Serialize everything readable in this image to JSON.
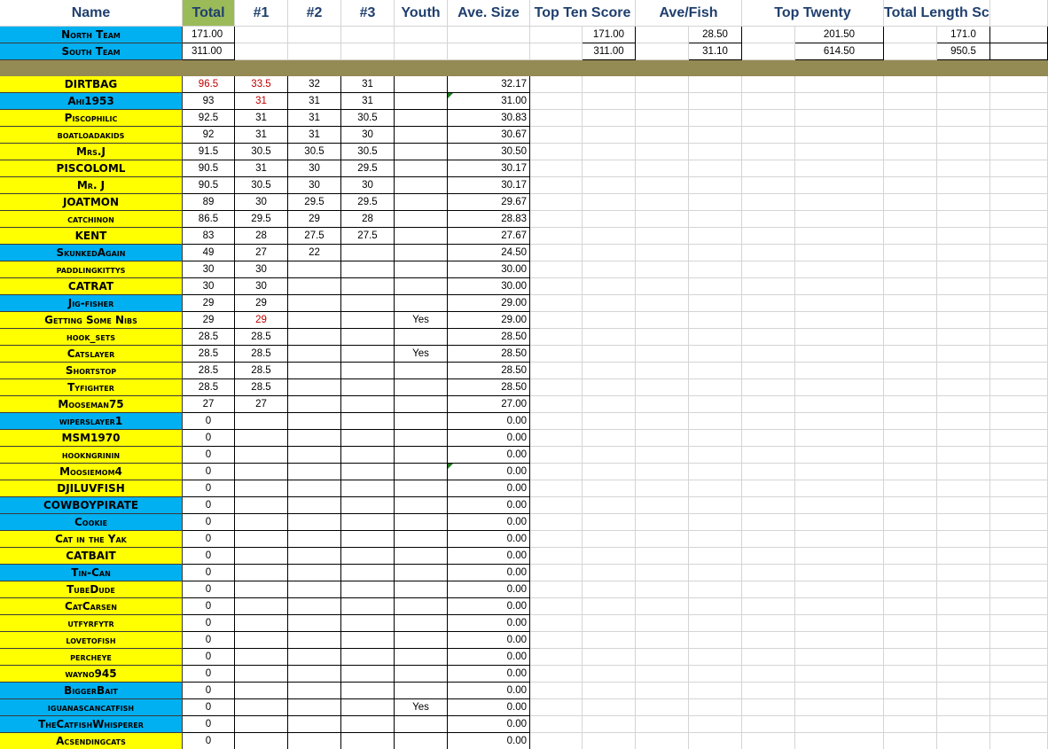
{
  "headers": {
    "name": "Name",
    "total": "Total",
    "r1": "#1",
    "r2": "#2",
    "r3": "#3",
    "youth": "Youth",
    "ave_size": "Ave. Size",
    "top_ten_score": "Top Ten Score",
    "ave_fish": "Ave/Fish",
    "top_twenty": "Top Twenty",
    "total_length_scored": "Total Length Scored"
  },
  "teams": [
    {
      "name": "North Team",
      "total": "171.00",
      "top_ten": "171.00",
      "ave_fish": "28.50",
      "top_twenty": "201.50",
      "total_length": "171.0"
    },
    {
      "name": "South Team",
      "total": "311.00",
      "top_ten": "311.00",
      "ave_fish": "31.10",
      "top_twenty": "614.50",
      "total_length": "950.5"
    }
  ],
  "colors": {
    "header_total": "#9bbb59",
    "header_text": "#1f3f6e",
    "band": "#948a54",
    "name_yellow": "#ffff00",
    "name_blue": "#00b0f0",
    "highlight_red": "#c00000",
    "comment_marker": "#1e7b1e"
  },
  "anglers": [
    {
      "name": "DIRTBAG",
      "color": "yellow",
      "total": "96.5",
      "r1": "33.5",
      "r2": "32",
      "r3": "31",
      "youth": "",
      "ave": "32.17",
      "total_red": true,
      "r1_red": true,
      "ave_marker": false
    },
    {
      "name": "Ahi1953",
      "color": "blue",
      "total": "93",
      "r1": "31",
      "r2": "31",
      "r3": "31",
      "youth": "",
      "ave": "31.00",
      "total_red": false,
      "r1_red": true,
      "ave_marker": true
    },
    {
      "name": "Piscophilic",
      "color": "yellow",
      "total": "92.5",
      "r1": "31",
      "r2": "31",
      "r3": "30.5",
      "youth": "",
      "ave": "30.83"
    },
    {
      "name": "boatloadakids",
      "color": "yellow",
      "total": "92",
      "r1": "31",
      "r2": "31",
      "r3": "30",
      "youth": "",
      "ave": "30.67"
    },
    {
      "name": "Mrs.J",
      "color": "yellow",
      "total": "91.5",
      "r1": "30.5",
      "r2": "30.5",
      "r3": "30.5",
      "youth": "",
      "ave": "30.50"
    },
    {
      "name": "PISCOLOML",
      "color": "yellow",
      "total": "90.5",
      "r1": "31",
      "r2": "30",
      "r3": "29.5",
      "youth": "",
      "ave": "30.17"
    },
    {
      "name": "Mr. J",
      "color": "yellow",
      "total": "90.5",
      "r1": "30.5",
      "r2": "30",
      "r3": "30",
      "youth": "",
      "ave": "30.17"
    },
    {
      "name": "JOATMON",
      "color": "yellow",
      "total": "89",
      "r1": "30",
      "r2": "29.5",
      "r3": "29.5",
      "youth": "",
      "ave": "29.67"
    },
    {
      "name": "catchinon",
      "color": "yellow",
      "total": "86.5",
      "r1": "29.5",
      "r2": "29",
      "r3": "28",
      "youth": "",
      "ave": "28.83"
    },
    {
      "name": "KENT",
      "color": "yellow",
      "total": "83",
      "r1": "28",
      "r2": "27.5",
      "r3": "27.5",
      "youth": "",
      "ave": "27.67"
    },
    {
      "name": "SkunkedAgain",
      "color": "blue",
      "total": "49",
      "r1": "27",
      "r2": "22",
      "r3": "",
      "youth": "",
      "ave": "24.50"
    },
    {
      "name": "paddlingkittys",
      "color": "yellow",
      "total": "30",
      "r1": "30",
      "r2": "",
      "r3": "",
      "youth": "",
      "ave": "30.00"
    },
    {
      "name": "CATRAT",
      "color": "yellow",
      "total": "30",
      "r1": "30",
      "r2": "",
      "r3": "",
      "youth": "",
      "ave": "30.00"
    },
    {
      "name": "Jig-fisher",
      "color": "blue",
      "total": "29",
      "r1": "29",
      "r2": "",
      "r3": "",
      "youth": "",
      "ave": "29.00"
    },
    {
      "name": "Getting Some Nibs",
      "color": "yellow",
      "total": "29",
      "r1": "29",
      "r2": "",
      "r3": "",
      "youth": "Yes",
      "ave": "29.00",
      "r1_red": true
    },
    {
      "name": "hook_sets",
      "color": "yellow",
      "total": "28.5",
      "r1": "28.5",
      "r2": "",
      "r3": "",
      "youth": "",
      "ave": "28.50"
    },
    {
      "name": "Catslayer",
      "color": "yellow",
      "total": "28.5",
      "r1": "28.5",
      "r2": "",
      "r3": "",
      "youth": "Yes",
      "ave": "28.50"
    },
    {
      "name": "Shortstop",
      "color": "yellow",
      "total": "28.5",
      "r1": "28.5",
      "r2": "",
      "r3": "",
      "youth": "",
      "ave": "28.50"
    },
    {
      "name": "Tyfighter",
      "color": "yellow",
      "total": "28.5",
      "r1": "28.5",
      "r2": "",
      "r3": "",
      "youth": "",
      "ave": "28.50"
    },
    {
      "name": "Mooseman75",
      "color": "yellow",
      "total": "27",
      "r1": "27",
      "r2": "",
      "r3": "",
      "youth": "",
      "ave": "27.00"
    },
    {
      "name": "wiperslayer1",
      "color": "blue",
      "total": "0",
      "r1": "",
      "r2": "",
      "r3": "",
      "youth": "",
      "ave": "0.00"
    },
    {
      "name": "MSM1970",
      "color": "yellow",
      "total": "0",
      "r1": "",
      "r2": "",
      "r3": "",
      "youth": "",
      "ave": "0.00"
    },
    {
      "name": "hookngrinin",
      "color": "yellow",
      "total": "0",
      "r1": "",
      "r2": "",
      "r3": "",
      "youth": "",
      "ave": "0.00"
    },
    {
      "name": "Moosiemom4",
      "color": "yellow",
      "total": "0",
      "r1": "",
      "r2": "",
      "r3": "",
      "youth": "",
      "ave": "0.00",
      "ave_marker": true
    },
    {
      "name": "DJILUVFISH",
      "color": "yellow",
      "total": "0",
      "r1": "",
      "r2": "",
      "r3": "",
      "youth": "",
      "ave": "0.00"
    },
    {
      "name": "COWBOYPIRATE",
      "color": "blue",
      "total": "0",
      "r1": "",
      "r2": "",
      "r3": "",
      "youth": "",
      "ave": "0.00"
    },
    {
      "name": "Cookie",
      "color": "blue",
      "total": "0",
      "r1": "",
      "r2": "",
      "r3": "",
      "youth": "",
      "ave": "0.00"
    },
    {
      "name": "Cat in the Yak",
      "color": "yellow",
      "total": "0",
      "r1": "",
      "r2": "",
      "r3": "",
      "youth": "",
      "ave": "0.00"
    },
    {
      "name": "CATBAIT",
      "color": "yellow",
      "total": "0",
      "r1": "",
      "r2": "",
      "r3": "",
      "youth": "",
      "ave": "0.00"
    },
    {
      "name": "Tin-Can",
      "color": "blue",
      "total": "0",
      "r1": "",
      "r2": "",
      "r3": "",
      "youth": "",
      "ave": "0.00"
    },
    {
      "name": "TubeDude",
      "color": "yellow",
      "total": "0",
      "r1": "",
      "r2": "",
      "r3": "",
      "youth": "",
      "ave": "0.00"
    },
    {
      "name": "CatCarsen",
      "color": "yellow",
      "total": "0",
      "r1": "",
      "r2": "",
      "r3": "",
      "youth": "",
      "ave": "0.00"
    },
    {
      "name": "utfyrfytr",
      "color": "yellow",
      "total": "0",
      "r1": "",
      "r2": "",
      "r3": "",
      "youth": "",
      "ave": "0.00"
    },
    {
      "name": "lovetofish",
      "color": "yellow",
      "total": "0",
      "r1": "",
      "r2": "",
      "r3": "",
      "youth": "",
      "ave": "0.00"
    },
    {
      "name": "percheye",
      "color": "yellow",
      "total": "0",
      "r1": "",
      "r2": "",
      "r3": "",
      "youth": "",
      "ave": "0.00"
    },
    {
      "name": "wayno945",
      "color": "yellow",
      "total": "0",
      "r1": "",
      "r2": "",
      "r3": "",
      "youth": "",
      "ave": "0.00"
    },
    {
      "name": "BiggerBait",
      "color": "blue",
      "total": "0",
      "r1": "",
      "r2": "",
      "r3": "",
      "youth": "",
      "ave": "0.00"
    },
    {
      "name": "iguanascancatfish",
      "color": "blue",
      "total": "0",
      "r1": "",
      "r2": "",
      "r3": "",
      "youth": "Yes",
      "ave": "0.00"
    },
    {
      "name": "TheCatfishWhisperer",
      "color": "blue",
      "total": "0",
      "r1": "",
      "r2": "",
      "r3": "",
      "youth": "",
      "ave": "0.00"
    },
    {
      "name": "Acsendingcats",
      "color": "yellow",
      "total": "0",
      "r1": "",
      "r2": "",
      "r3": "",
      "youth": "",
      "ave": "0.00"
    }
  ]
}
